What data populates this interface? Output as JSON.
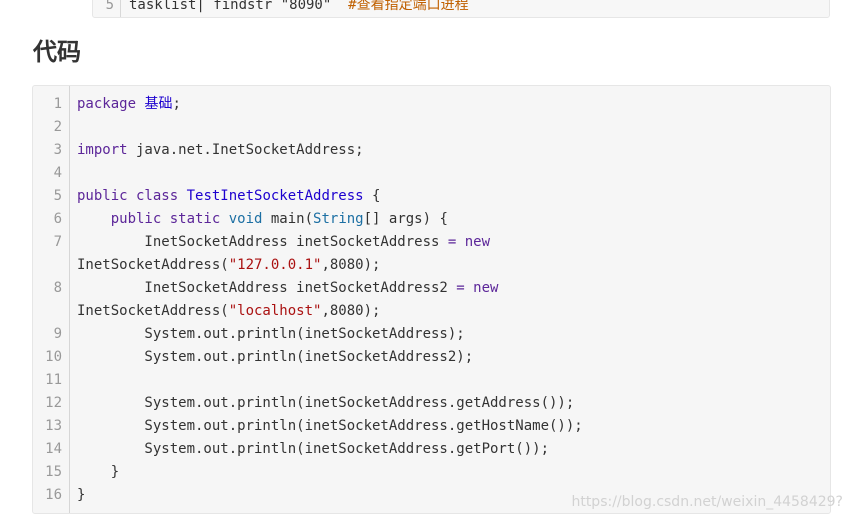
{
  "previous_block": {
    "line_number": "5",
    "code": "tasklist| findstr \"8090\"",
    "comment": "#查看指定端口进程"
  },
  "section_title": "代码",
  "code": {
    "lines": [
      {
        "n": "1",
        "segments": [
          [
            "kw",
            "package"
          ],
          [
            "pl",
            " "
          ],
          [
            "ty",
            "基础"
          ],
          [
            "pl",
            ";"
          ]
        ]
      },
      {
        "n": "2",
        "segments": []
      },
      {
        "n": "3",
        "segments": [
          [
            "kw",
            "import"
          ],
          [
            "pl",
            " java.net.InetSocketAddress;"
          ]
        ]
      },
      {
        "n": "4",
        "segments": []
      },
      {
        "n": "5",
        "segments": [
          [
            "kw",
            "public class"
          ],
          [
            "pl",
            " "
          ],
          [
            "ty",
            "TestInetSocketAddress"
          ],
          [
            "pl",
            " {"
          ]
        ]
      },
      {
        "n": "6",
        "segments": [
          [
            "pl",
            "    "
          ],
          [
            "kw",
            "public static"
          ],
          [
            "pl",
            " "
          ],
          [
            "cls",
            "void"
          ],
          [
            "pl",
            " main("
          ],
          [
            "cls",
            "String"
          ],
          [
            "pl",
            "[] args) {"
          ]
        ]
      },
      {
        "n": "7",
        "segments": [
          [
            "pl",
            "        InetSocketAddress inetSocketAddress "
          ],
          [
            "kw",
            "= new"
          ]
        ]
      },
      {
        "n": "",
        "segments": [
          [
            "pl",
            "InetSocketAddress("
          ],
          [
            "str",
            "\"127.0.0.1\""
          ],
          [
            "pl",
            ",8080);"
          ]
        ]
      },
      {
        "n": "8",
        "segments": [
          [
            "pl",
            "        InetSocketAddress inetSocketAddress2 "
          ],
          [
            "kw",
            "= new"
          ]
        ]
      },
      {
        "n": "",
        "segments": [
          [
            "pl",
            "InetSocketAddress("
          ],
          [
            "str",
            "\"localhost\""
          ],
          [
            "pl",
            ",8080);"
          ]
        ]
      },
      {
        "n": "9",
        "segments": [
          [
            "pl",
            "        System.out.println(inetSocketAddress);"
          ]
        ]
      },
      {
        "n": "10",
        "segments": [
          [
            "pl",
            "        System.out.println(inetSocketAddress2);"
          ]
        ]
      },
      {
        "n": "11",
        "segments": []
      },
      {
        "n": "12",
        "segments": [
          [
            "pl",
            "        System.out.println(inetSocketAddress.getAddress());"
          ]
        ]
      },
      {
        "n": "13",
        "segments": [
          [
            "pl",
            "        System.out.println(inetSocketAddress.getHostName());"
          ]
        ]
      },
      {
        "n": "14",
        "segments": [
          [
            "pl",
            "        System.out.println(inetSocketAddress.getPort());"
          ]
        ]
      },
      {
        "n": "15",
        "segments": [
          [
            "pl",
            "    }"
          ]
        ]
      },
      {
        "n": "16",
        "segments": [
          [
            "pl",
            "}"
          ]
        ]
      }
    ]
  },
  "watermark": "https://blog.csdn.net/weixin_4458429?"
}
